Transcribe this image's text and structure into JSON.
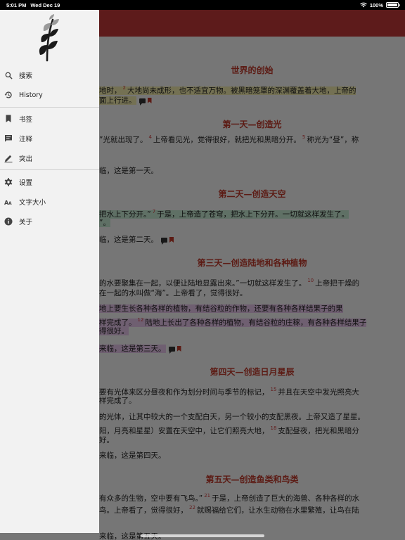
{
  "status": {
    "time": "5:01 PM",
    "date": "Wed Dec 19",
    "battery": "100%",
    "battery_level": 1.0
  },
  "drawer": {
    "items": [
      {
        "label": "搜索",
        "icon": "search-icon"
      },
      {
        "label": "History",
        "icon": "history-icon"
      },
      {
        "label": "书签",
        "icon": "bookmark-icon"
      },
      {
        "label": "注释",
        "icon": "comment-icon"
      },
      {
        "label": "突出",
        "icon": "highlighter-icon"
      },
      {
        "label": "设置",
        "icon": "gear-icon"
      },
      {
        "label": "文字大小",
        "icon": "text-size-icon"
      },
      {
        "label": "关于",
        "icon": "info-icon"
      }
    ]
  },
  "reader": {
    "sections": [
      {
        "title": "世界的创始",
        "lines": [
          {
            "t": "地时，",
            "vn": "2",
            "t2": "大地尚未成形，也不适宜万物。被黑暗笼罩的深渊覆盖着大地，上帝的",
            "hl": "yellow"
          },
          {
            "t": "面上行进。",
            "hl": "yellow",
            "marks": true
          }
        ]
      },
      {
        "title": "第一天—创造光",
        "lines": [
          {
            "t": "”光就出现了。",
            "vn": "4",
            "t2": "上帝看见光，觉得很好，就把光和黑暗分开。",
            "vn2": "5",
            "t3": "称光为“昼”，称"
          },
          {
            "t": "临，这是第一天。"
          }
        ]
      },
      {
        "title": "第二天—创造天空",
        "lines": [
          {
            "t": "把水上下分开。”",
            "vn": "7",
            "t2": "于是，上帝造了苍穹，把水上下分开。一切就这样发生了。",
            "hl": "green"
          },
          {
            "t": "”。",
            "hl": "green"
          },
          {
            "t": "临，这是第二天。",
            "marks": true
          }
        ]
      },
      {
        "title": "第三天—创造陆地和各种植物",
        "lines": [
          {
            "t": "的水要聚集在一起，以便让陆地显露出来。”一切就这样发生了。",
            "vn": "10",
            "t2": "上帝把干燥的"
          },
          {
            "t": "在一起的水叫做“海”。上帝看了，觉得很好。"
          },
          {
            "t": "地上要生长各种各样的植物，有结谷粒的作物，还要有各种各样结果子的果",
            "hl": "purple"
          },
          {
            "t": "样完成了。",
            "vn": "12",
            "t2": "陆地上长出了各种各样的植物，有结谷粒的庄稼，有各种各样结果子",
            "hl": "purple"
          },
          {
            "t": "得很好。",
            "hl": "purple"
          },
          {
            "t": "来临，这是第三天。",
            "hl": "purple",
            "marks": true
          }
        ]
      },
      {
        "title": "第四天—创造日月星辰",
        "lines": [
          {
            "t": "要有光体来区分昼夜和作为划分时间与季节的标记，",
            "vn": "15",
            "t2": "并且在天空中发光照亮大"
          },
          {
            "t": "样完成了。"
          },
          {
            "t": "的光体，让其中较大的一个支配白天，另一个较小的支配黑夜。上帝又造了星星。"
          },
          {
            "t": "阳，月亮和星星）安置在天空中，让它们照亮大地，",
            "vn": "18",
            "t2": "支配昼夜，把光和黑暗分"
          },
          {
            "t": "好。"
          },
          {
            "t": "来临，这是第四天。"
          }
        ]
      },
      {
        "title": "第五天—创造鱼类和鸟类",
        "lines": [
          {
            "t": "有众多的生物，空中要有飞鸟。”",
            "vn": "21",
            "t2": "于是，上帝创造了巨大的海兽、各种各样的水"
          },
          {
            "t": "鸟。上帝看了，觉得很好，",
            "vn": "22",
            "t2": "就赐福给它们，让水生动物在水里繁殖，让鸟在陆"
          },
          {
            "t": "来临，这是第五天。"
          }
        ]
      }
    ]
  }
}
